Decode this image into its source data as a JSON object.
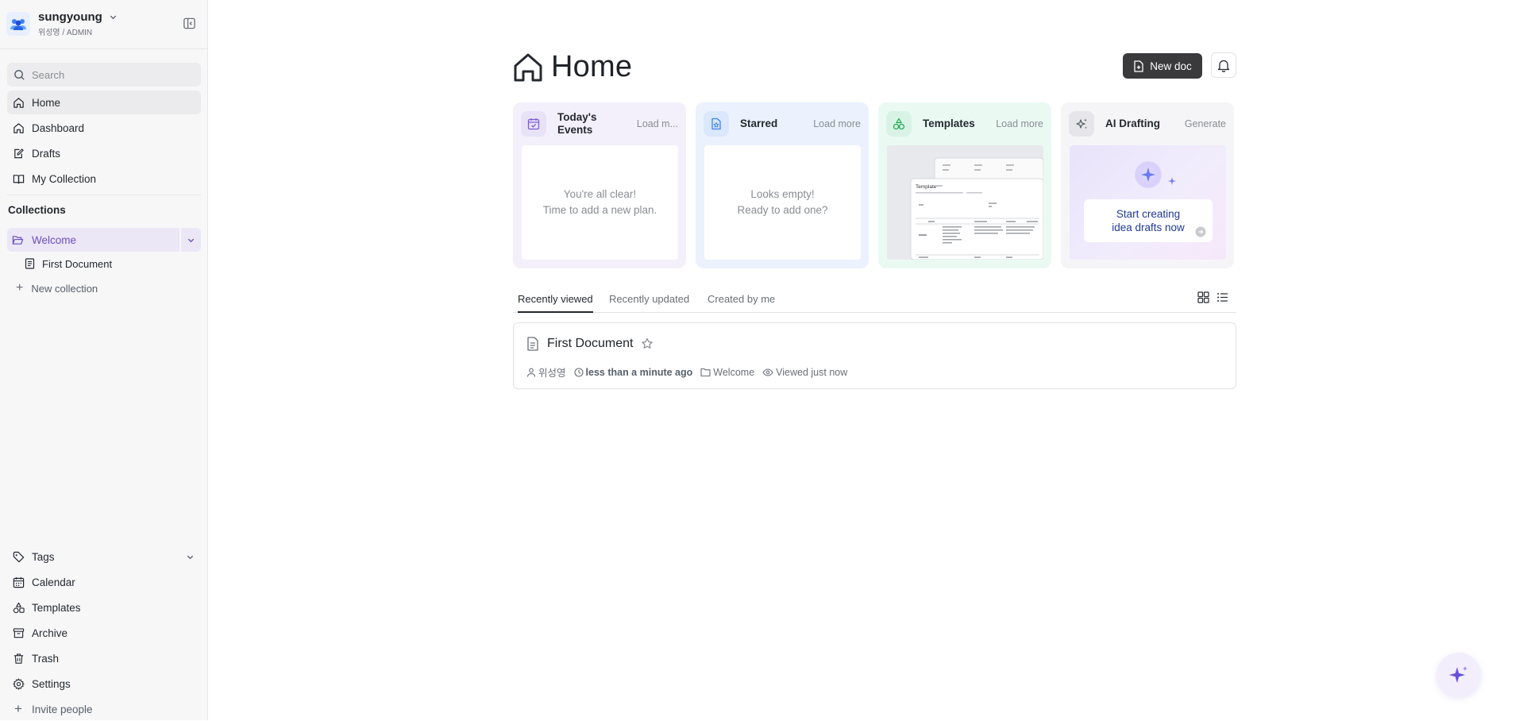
{
  "workspace": {
    "name": "sungyoung",
    "role": "위성영 / ADMIN"
  },
  "search": {
    "placeholder": "Search"
  },
  "nav": {
    "home": "Home",
    "dashboard": "Dashboard",
    "drafts": "Drafts",
    "my_collection": "My Collection"
  },
  "collections": {
    "title": "Collections",
    "items": [
      {
        "label": "Welcome",
        "color": "#6b4ec2"
      }
    ],
    "documents": [
      "First Document"
    ],
    "new_label": "New collection"
  },
  "bottom_nav": {
    "tags": "Tags",
    "calendar": "Calendar",
    "templates": "Templates",
    "archive": "Archive",
    "trash": "Trash",
    "settings": "Settings",
    "invite": "Invite people"
  },
  "header": {
    "title": "Home",
    "new_doc": "New doc"
  },
  "cards": [
    {
      "title": "Today's Events",
      "action": "Load m...",
      "line1": "You're all clear!",
      "line2": "Time to add a new plan.",
      "bg": "#f3f0fb",
      "icon_bg": "#e8e2f7",
      "icon": "calendar-check-icon"
    },
    {
      "title": "Starred",
      "action": "Load more",
      "line1": "Looks empty!",
      "line2": "Ready to add one?",
      "bg": "#ebf2fe",
      "icon_bg": "#dbe7fc",
      "icon": "star-doc-icon"
    },
    {
      "title": "Templates",
      "action": "Load more",
      "bg": "#eafaf3",
      "icon_bg": "#d8f3e6",
      "icon": "shapes-icon",
      "preview_title": "Template"
    },
    {
      "title": "AI Drafting",
      "action": "Generate",
      "line1": "Start creating",
      "line2": "idea drafts now",
      "bg": "#f5f5f7",
      "icon_bg": "#e6e6ea",
      "icon": "sparkles-icon"
    }
  ],
  "tabs": [
    "Recently viewed",
    "Recently updated",
    "Created by me"
  ],
  "recent_doc": {
    "title": "First Document",
    "author": "위성영",
    "updated": "less than a minute ago",
    "collection": "Welcome",
    "viewed": "Viewed just now"
  }
}
